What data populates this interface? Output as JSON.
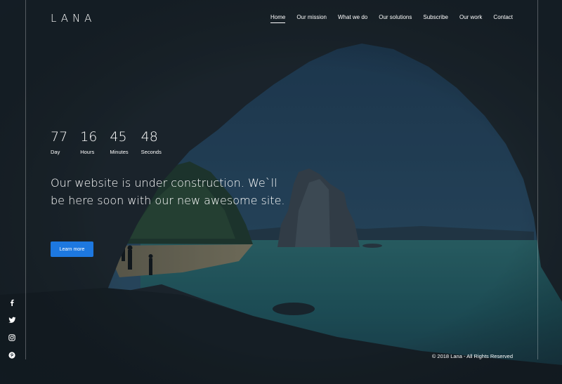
{
  "brand": {
    "logo": "LANA"
  },
  "nav": {
    "items": [
      {
        "label": "Home",
        "active": true
      },
      {
        "label": "Our mission",
        "active": false
      },
      {
        "label": "What we do",
        "active": false
      },
      {
        "label": "Our solutions",
        "active": false
      },
      {
        "label": "Subscribe",
        "active": false
      },
      {
        "label": "Our work",
        "active": false
      },
      {
        "label": "Contact",
        "active": false
      }
    ]
  },
  "countdown": [
    {
      "value": "77",
      "label": "Day"
    },
    {
      "value": "16",
      "label": "Hours"
    },
    {
      "value": "45",
      "label": "Minutes"
    },
    {
      "value": "48",
      "label": "Seconds"
    }
  ],
  "hero": {
    "headline": "Our website is under construction. We`ll be here soon with our new awesome site.",
    "cta_label": "Learn more"
  },
  "social": [
    {
      "icon": "facebook-icon"
    },
    {
      "icon": "twitter-icon"
    },
    {
      "icon": "instagram-icon"
    },
    {
      "icon": "pinterest-icon"
    }
  ],
  "footer": {
    "copyright": "© 2018 Lana - All Rights Reserved"
  },
  "colors": {
    "accent": "#1d78e0",
    "background": "#1e2a34"
  }
}
